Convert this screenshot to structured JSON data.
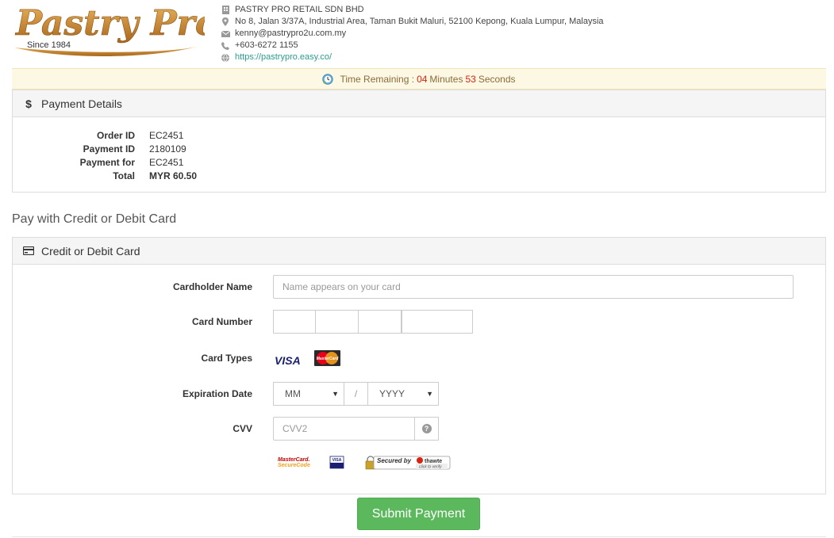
{
  "header": {
    "logo_text": "Pastry Pro",
    "logo_since": "Since 1984",
    "company_name": "PASTRY PRO RETAIL SDN BHD",
    "address": "No 8, Jalan 3/37A, Industrial Area, Taman Bukit Maluri, 52100 Kepong, Kuala Lumpur, Malaysia",
    "email": "kenny@pastrypro2u.com.my",
    "phone": "+603-6272 1155",
    "website": "https://pastrypro.easy.co/"
  },
  "timer": {
    "prefix": "Time Remaining :",
    "minutes": "04",
    "minutes_label": "Minutes",
    "seconds": "53",
    "seconds_label": "Seconds"
  },
  "payment_details": {
    "title": "Payment Details",
    "rows": [
      {
        "label": "Order ID",
        "value": "EC2451"
      },
      {
        "label": "Payment ID",
        "value": "2180109"
      },
      {
        "label": "Payment for",
        "value": "EC2451"
      },
      {
        "label": "Total",
        "value": "MYR 60.50"
      }
    ]
  },
  "pay_with_heading": "Pay with Credit or Debit Card",
  "card_form": {
    "title": "Credit or Debit Card",
    "cardholder_label": "Cardholder Name",
    "cardholder_placeholder": "Name appears on your card",
    "card_number_label": "Card Number",
    "card_types_label": "Card Types",
    "visa_label": "VISA",
    "mastercard_label": "MasterCard",
    "expiration_label": "Expiration Date",
    "month_value": "MM",
    "year_value": "YYYY",
    "slash": "/",
    "cvv_label": "CVV",
    "cvv_placeholder": "CVV2",
    "securecode_line1": "MasterCard.",
    "securecode_line2": "SecureCode",
    "verified_visa": "VISA",
    "thawte_line1": "Secured by",
    "thawte_brand": "thawte",
    "thawte_line2": "click to verify"
  },
  "submit_label": "Submit Payment",
  "colors": {
    "accent_green": "#5cb85c",
    "timer_bg": "#fcf8e3",
    "timer_red": "#d9230f",
    "logo_gold": "#c8892f"
  }
}
